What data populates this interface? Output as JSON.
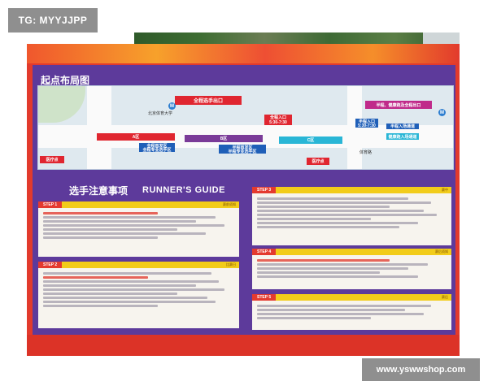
{
  "watermark_top": "TG: MYYJJPP",
  "watermark_bottom": "www.yswwshop.com",
  "map": {
    "title": "起点布局图",
    "labels": {
      "elite_exit": "全程选手出口",
      "half_exit": "半程、健康跑及全程出口",
      "full_entry": "全程入口",
      "full_entry_time": "5:30-7:30",
      "half_entry": "半程入口",
      "half_entry_time": "5:30-7:30",
      "half_area": "半程入场通道",
      "health_area": "健康跑入场通道",
      "zone_a": "A区",
      "zone_b": "B区",
      "zone_c": "C区",
      "zone_first": "全程首发区",
      "zone_first_sub": "全程专业选手区",
      "zone_half": "半程首发区",
      "zone_half_sub": "半程专业选手区",
      "medical_1": "医疗点",
      "medical_2": "医疗点",
      "building": "北京体育大学",
      "road": "体育路"
    }
  },
  "guide": {
    "title_cn": "选手注意事项",
    "title_en": "RUNNER'S GUIDE",
    "steps": [
      {
        "label": "STEP 1",
        "heading": "赛前须知"
      },
      {
        "label": "STEP 2",
        "heading": "比赛日"
      },
      {
        "label": "STEP 3",
        "heading": "赛中"
      },
      {
        "label": "STEP 4",
        "heading": "赛后须知"
      },
      {
        "label": "STEP 5",
        "heading": "赛后"
      }
    ]
  },
  "colors": {
    "board_red": "#e23a2c",
    "panel_purple": "#5d3a9b",
    "step_yellow": "#f2cc1a",
    "zone_red": "#e02630",
    "zone_purple": "#7a3b98",
    "zone_blue": "#1f5fb8",
    "zone_cyan": "#29b6d6"
  }
}
